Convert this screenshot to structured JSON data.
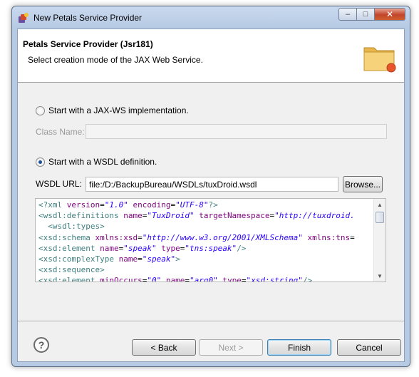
{
  "window": {
    "title": "New Petals Service Provider",
    "icon": "petals-wizard-icon",
    "controls": {
      "minimize": "–",
      "maximize": "□",
      "close": "✕"
    }
  },
  "header": {
    "title": "Petals Service Provider (Jsr181)",
    "description": "Select creation mode of the JAX Web Service.",
    "icon": "folder-icon"
  },
  "options": {
    "jaxws": {
      "label": "Start with a JAX-WS implementation.",
      "checked": false
    },
    "class_name": {
      "label": "Class Name:",
      "value": "",
      "enabled": false
    },
    "wsdl": {
      "label": "Start with a WSDL definition.",
      "checked": true
    },
    "wsdl_url": {
      "label": "WSDL URL:",
      "value": "file:/D:/BackupBureau/WSDLs/tuxDroid.wsdl"
    },
    "browse_label": "Browse..."
  },
  "xml_preview": {
    "lines": [
      [
        [
          "pi",
          "<?xml "
        ],
        [
          "attr",
          "version"
        ],
        [
          "txt",
          "="
        ],
        [
          "val",
          "\"1.0\""
        ],
        [
          "txt",
          " "
        ],
        [
          "attr",
          "encoding"
        ],
        [
          "txt",
          "="
        ],
        [
          "val",
          "\"UTF-8\""
        ],
        [
          "pi",
          "?>"
        ]
      ],
      [
        [
          "tag",
          "<wsdl:definitions "
        ],
        [
          "attr",
          "name"
        ],
        [
          "txt",
          "="
        ],
        [
          "val",
          "\"TuxDroid\""
        ],
        [
          "txt",
          " "
        ],
        [
          "attr",
          "targetNamespace"
        ],
        [
          "txt",
          "="
        ],
        [
          "val",
          "\"http://tuxdroid."
        ]
      ],
      [
        [
          "txt",
          "  "
        ],
        [
          "tag",
          "<wsdl:types>"
        ]
      ],
      [
        [
          "tag",
          "<xsd:schema "
        ],
        [
          "attr",
          "xmlns:xsd"
        ],
        [
          "txt",
          "="
        ],
        [
          "val",
          "\"http://www.w3.org/2001/XMLSchema\""
        ],
        [
          "txt",
          " "
        ],
        [
          "attr",
          "xmlns:tns"
        ],
        [
          "txt",
          "="
        ]
      ],
      [
        [
          "tag",
          "<xsd:element "
        ],
        [
          "attr",
          "name"
        ],
        [
          "txt",
          "="
        ],
        [
          "val",
          "\"speak\""
        ],
        [
          "txt",
          " "
        ],
        [
          "attr",
          "type"
        ],
        [
          "txt",
          "="
        ],
        [
          "val",
          "\"tns:speak\""
        ],
        [
          "tag",
          "/>"
        ]
      ],
      [
        [
          "tag",
          "<xsd:complexType "
        ],
        [
          "attr",
          "name"
        ],
        [
          "txt",
          "="
        ],
        [
          "val",
          "\"speak\""
        ],
        [
          "tag",
          ">"
        ]
      ],
      [
        [
          "tag",
          "<xsd:sequence>"
        ]
      ],
      [
        [
          "tag",
          "<xsd:element "
        ],
        [
          "attr",
          "minOccurs"
        ],
        [
          "txt",
          "="
        ],
        [
          "val",
          "\"0\""
        ],
        [
          "txt",
          " "
        ],
        [
          "attr",
          "name"
        ],
        [
          "txt",
          "="
        ],
        [
          "val",
          "\"arg0\""
        ],
        [
          "txt",
          " "
        ],
        [
          "attr",
          "type"
        ],
        [
          "txt",
          "="
        ],
        [
          "val",
          "\"xsd:string\""
        ],
        [
          "tag",
          "/>"
        ]
      ]
    ]
  },
  "footer": {
    "help_icon": "help-icon",
    "help_glyph": "?",
    "back_label": "< Back",
    "next_label": "Next >",
    "finish_label": "Finish",
    "cancel_label": "Cancel"
  }
}
